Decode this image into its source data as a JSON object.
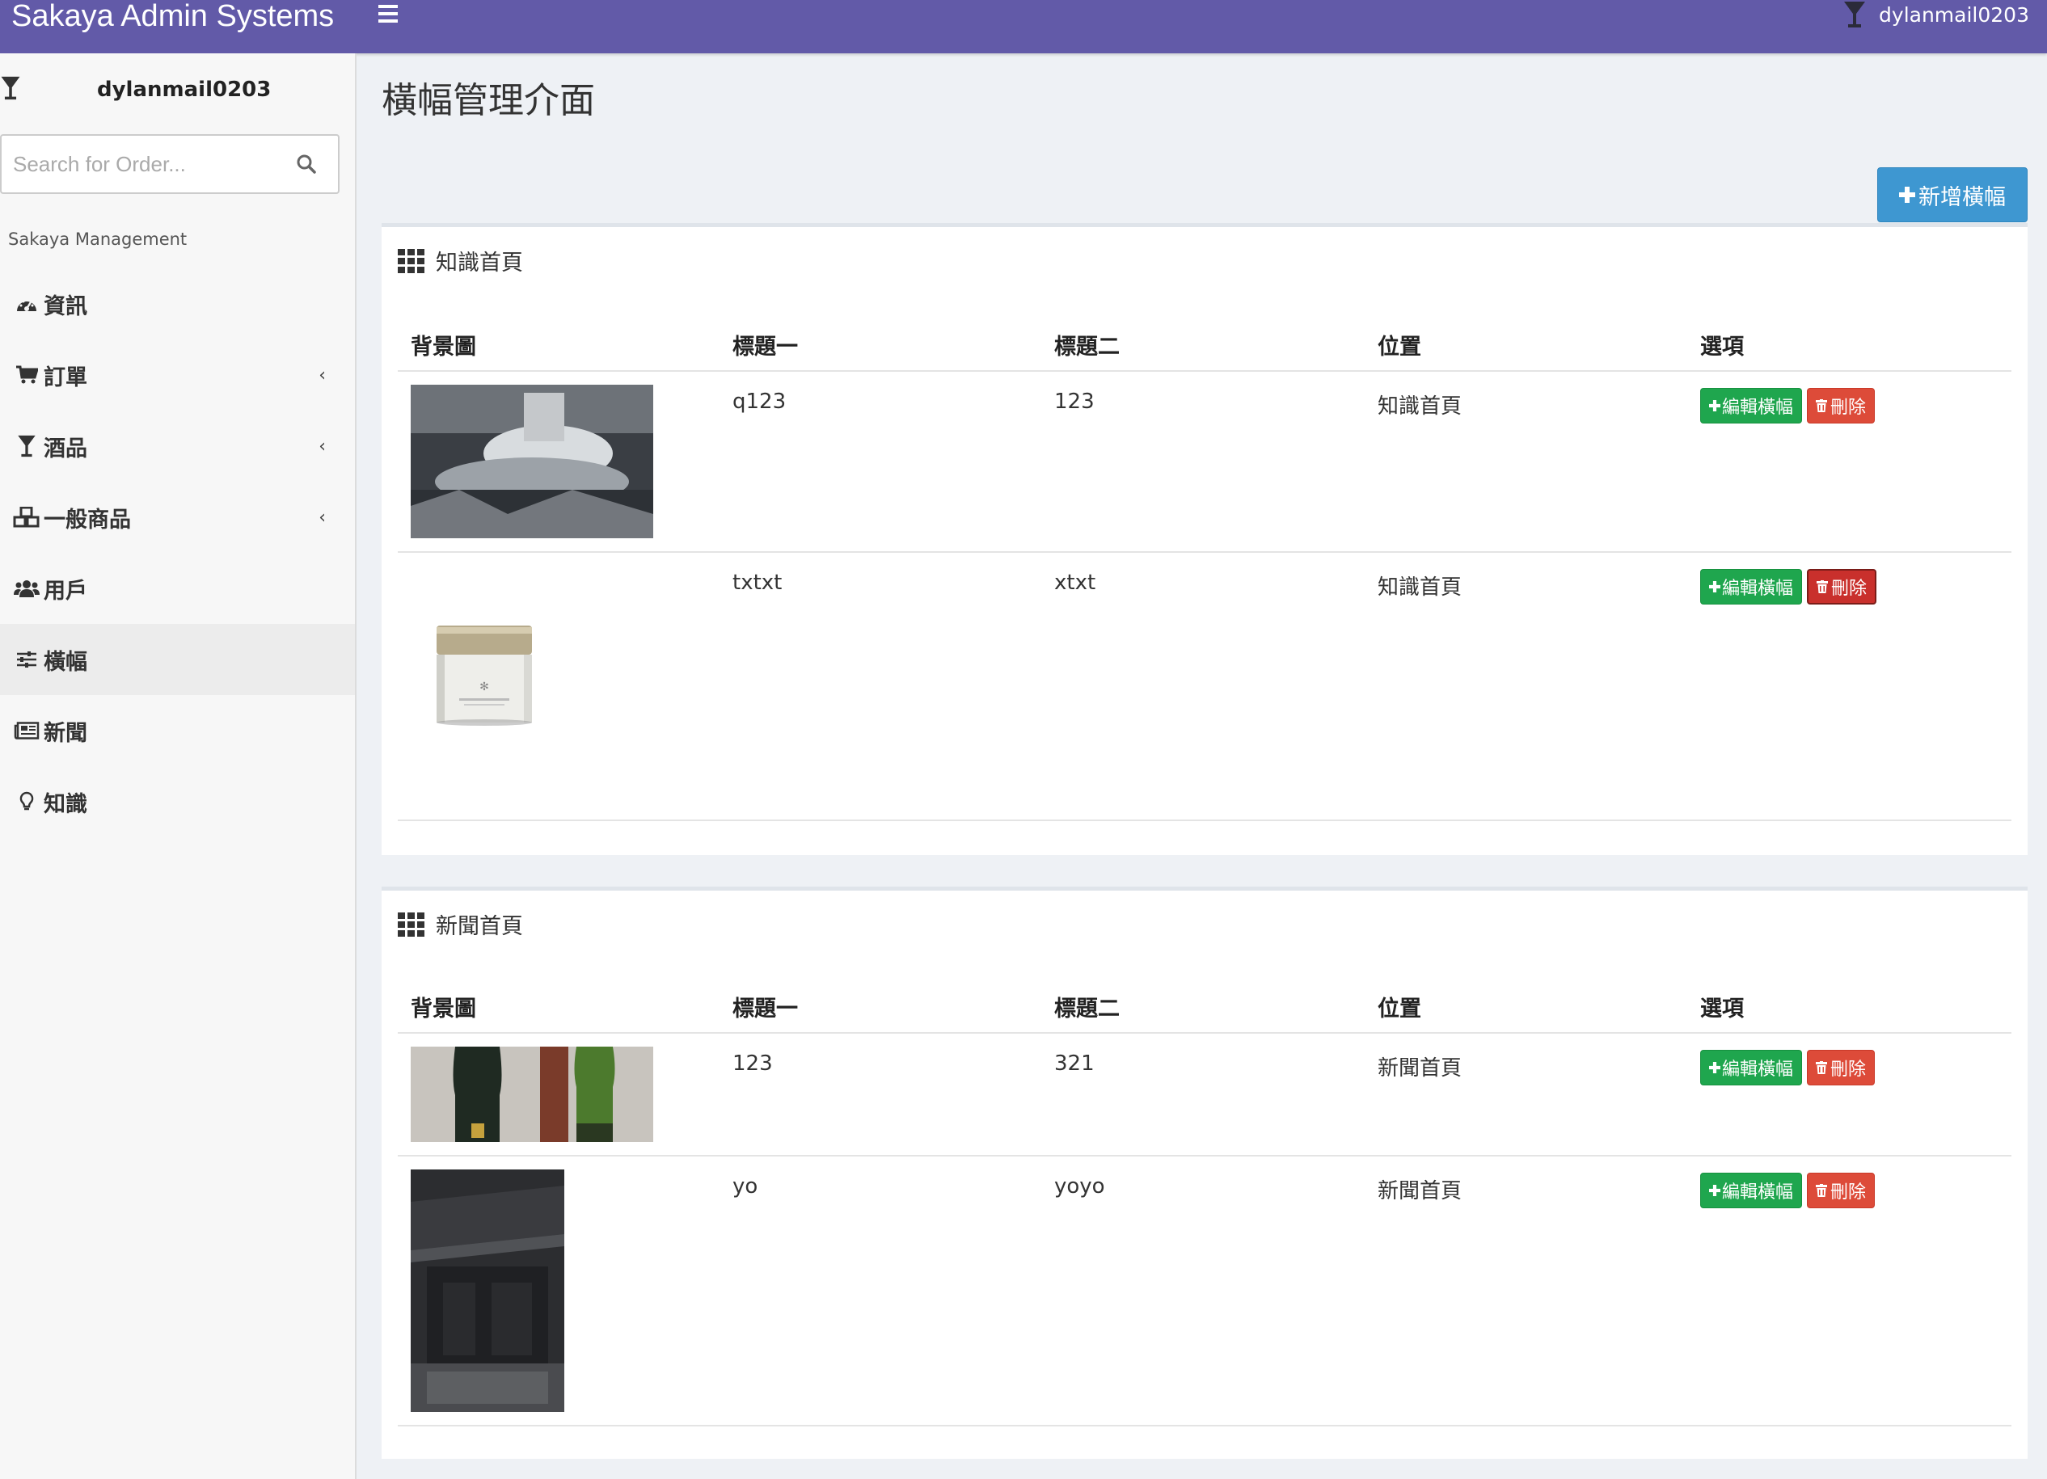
{
  "app": {
    "brand": "Sakaya Admin Systems",
    "user": "dylanmail0203"
  },
  "sidebar": {
    "user": "dylanmail0203",
    "search_placeholder": "Search for Order...",
    "heading": "Sakaya Management",
    "items": [
      {
        "label": "資訊",
        "icon": "dashboard-icon"
      },
      {
        "label": "訂單",
        "icon": "cart-icon"
      },
      {
        "label": "酒品",
        "icon": "glass-icon"
      },
      {
        "label": "一般商品",
        "icon": "cubes-icon"
      },
      {
        "label": "用戶",
        "icon": "users-icon"
      },
      {
        "label": "橫幅",
        "icon": "sliders-icon"
      },
      {
        "label": "新聞",
        "icon": "newspaper-icon"
      },
      {
        "label": "知識",
        "icon": "lightbulb-icon"
      }
    ]
  },
  "main": {
    "title": "橫幅管理介面",
    "add_button": "新增橫幅",
    "columns": [
      "背景圖",
      "標題一",
      "標題二",
      "位置",
      "選項"
    ],
    "edit_label": "編輯橫幅",
    "delete_label": "刪除",
    "panels": [
      {
        "title": "知識首頁",
        "rows": [
          {
            "title1": "q123",
            "title2": "123",
            "position": "知識首頁"
          },
          {
            "title1": "txtxt",
            "title2": "xtxt",
            "position": "知識首頁"
          }
        ]
      },
      {
        "title": "新聞首頁",
        "rows": [
          {
            "title1": "123",
            "title2": "321",
            "position": "新聞首頁"
          },
          {
            "title1": "yo",
            "title2": "yoyo",
            "position": "新聞首頁"
          }
        ]
      }
    ]
  },
  "colors": {
    "topbar": "#625aa8",
    "primary": "#3e97d1",
    "success": "#1fa64e",
    "danger": "#dd4b39"
  }
}
